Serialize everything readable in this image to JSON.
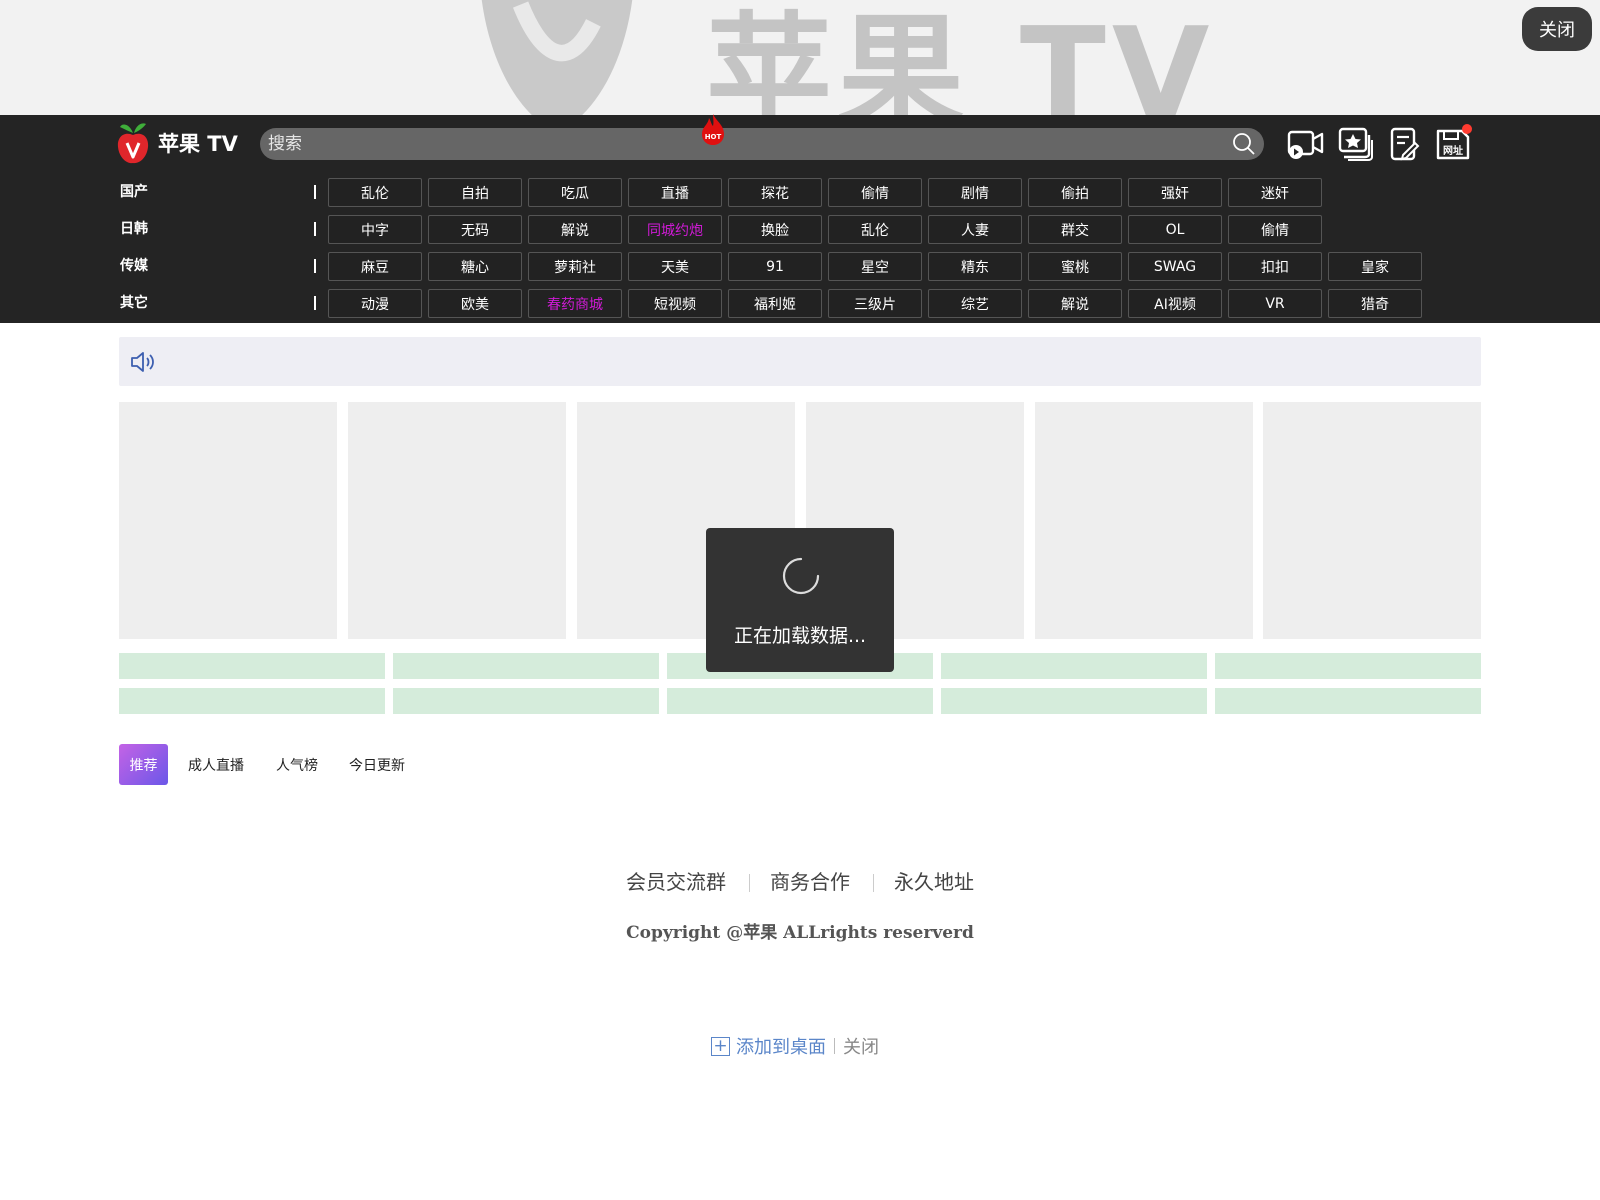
{
  "banner": {
    "title": "苹果 TV",
    "close_label": "关闭"
  },
  "header": {
    "logo_text": "苹果 TV",
    "search_placeholder": "搜索",
    "icons": [
      "video-icon",
      "star-album-icon",
      "edit-note-icon",
      "save-url-icon"
    ],
    "save_url_label": "网址"
  },
  "categories": [
    {
      "title": "国产",
      "items": [
        "乱伦",
        "自拍",
        "吃瓜",
        "直播",
        "探花",
        "偷情",
        "剧情",
        "偷拍",
        "强奸",
        "迷奸"
      ]
    },
    {
      "title": "日韩",
      "items": [
        "中字",
        "无码",
        "解说",
        "同城约炮",
        "换脸",
        "乱伦",
        "人妻",
        "群交",
        "OL",
        "偷情"
      ]
    },
    {
      "title": "传媒",
      "items": [
        "麻豆",
        "糖心",
        "萝莉社",
        "天美",
        "91",
        "星空",
        "精东",
        "蜜桃",
        "SWAG",
        "扣扣",
        "皇家"
      ]
    },
    {
      "title": "其它",
      "items": [
        "动漫",
        "欧美",
        "春药商城",
        "短视频",
        "福利姬",
        "三级片",
        "综艺",
        "解说",
        "AI视频",
        "VR",
        "猎奇"
      ]
    }
  ],
  "highlight_color": "#d01ad6",
  "hot_badge_label": "HOT",
  "loading": {
    "text": "正在加载数据..."
  },
  "tabs": [
    {
      "label": "推荐",
      "active": true
    },
    {
      "label": "成人直播",
      "active": false
    },
    {
      "label": "人气榜",
      "active": false
    },
    {
      "label": "今日更新",
      "active": false
    }
  ],
  "footer": {
    "links": [
      "会员交流群",
      "商务合作",
      "永久地址"
    ],
    "copyright": "Copyright @苹果 ALLrights reserverd",
    "add_to_desktop": "添加到桌面",
    "close_label": "关闭"
  }
}
